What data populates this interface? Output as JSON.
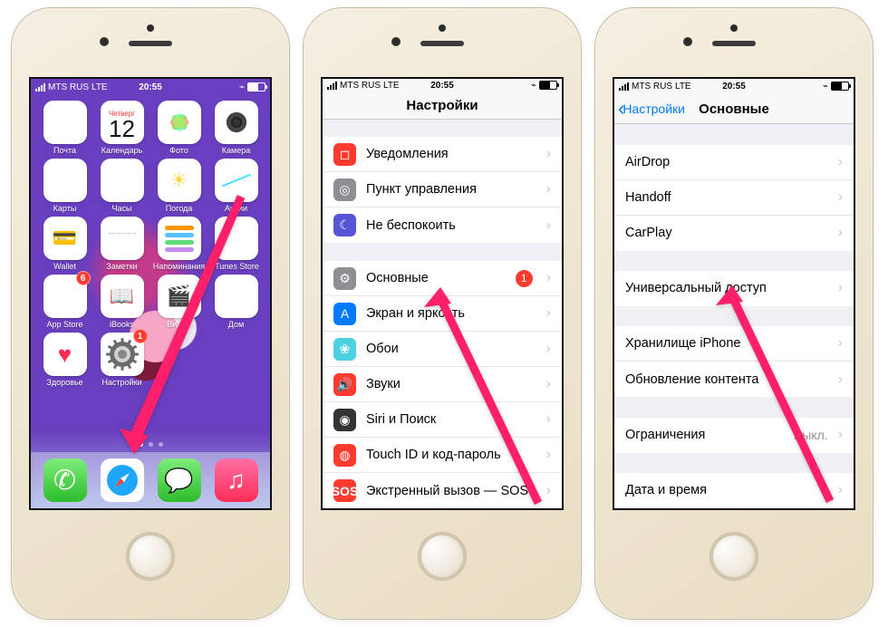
{
  "status": {
    "carrier": "MTS RUS",
    "net": "LTE",
    "time": "20:55"
  },
  "home": {
    "calendar": {
      "dow": "Четверг",
      "day": "12"
    },
    "rows": [
      [
        {
          "name": "mail",
          "label": "Почта",
          "cls": "ic-mail"
        },
        {
          "name": "calendar",
          "label": "Календарь",
          "cls": "ic-cal"
        },
        {
          "name": "photos",
          "label": "Фото",
          "cls": "ic-photos"
        },
        {
          "name": "camera",
          "label": "Камера",
          "cls": "ic-cam"
        }
      ],
      [
        {
          "name": "maps",
          "label": "Карты",
          "cls": "ic-maps"
        },
        {
          "name": "clock",
          "label": "Часы",
          "cls": "ic-clock"
        },
        {
          "name": "weather",
          "label": "Погода",
          "cls": "ic-weather"
        },
        {
          "name": "stocks",
          "label": "Акции",
          "cls": "ic-stocks"
        }
      ],
      [
        {
          "name": "wallet",
          "label": "Wallet",
          "cls": "ic-wallet"
        },
        {
          "name": "notes",
          "label": "Заметки",
          "cls": "ic-notes"
        },
        {
          "name": "reminders",
          "label": "Напоминания",
          "cls": "ic-remind"
        },
        {
          "name": "itunes",
          "label": "iTunes Store",
          "cls": "ic-itunes"
        }
      ],
      [
        {
          "name": "appstore",
          "label": "App Store",
          "cls": "ic-appst",
          "badge": "6"
        },
        {
          "name": "ibooks",
          "label": "iBooks",
          "cls": "ic-ibooks"
        },
        {
          "name": "video",
          "label": "Видео",
          "cls": "ic-video"
        },
        {
          "name": "home",
          "label": "Дом",
          "cls": "ic-home"
        }
      ],
      [
        {
          "name": "health",
          "label": "Здоровье",
          "cls": "ic-health"
        },
        {
          "name": "settings",
          "label": "Настройки",
          "cls": "ic-settings",
          "badge": "1"
        }
      ]
    ],
    "dock": [
      {
        "name": "phone",
        "cls": "ic-phone"
      },
      {
        "name": "safari",
        "cls": "ic-safari"
      },
      {
        "name": "messages",
        "cls": "ic-msg"
      },
      {
        "name": "music",
        "cls": "ic-music"
      }
    ]
  },
  "settings": {
    "title": "Настройки",
    "group1": [
      {
        "name": "notifications",
        "label": "Уведомления",
        "icon": "si-red",
        "glyph": "◻"
      },
      {
        "name": "control-center",
        "label": "Пункт управления",
        "icon": "si-gray",
        "glyph": "◎"
      },
      {
        "name": "dnd",
        "label": "Не беспокоить",
        "icon": "si-purple",
        "glyph": "☾"
      }
    ],
    "group2": [
      {
        "name": "general",
        "label": "Основные",
        "icon": "si-gray",
        "glyph": "⚙",
        "badge": "1"
      },
      {
        "name": "display",
        "label": "Экран и яркость",
        "icon": "si-blue",
        "glyph": "A"
      },
      {
        "name": "wallpaper",
        "label": "Обои",
        "icon": "si-teal",
        "glyph": "❀"
      },
      {
        "name": "sounds",
        "label": "Звуки",
        "icon": "si-red",
        "glyph": "🔊"
      },
      {
        "name": "siri",
        "label": "Siri и Поиск",
        "icon": "si-dark",
        "glyph": "◉"
      },
      {
        "name": "touchid",
        "label": "Touch ID и код-пароль",
        "icon": "si-red",
        "glyph": "◍"
      },
      {
        "name": "sos",
        "label": "Экстренный вызов — SOS",
        "icon": "si-sos",
        "glyph": "SOS"
      }
    ]
  },
  "general": {
    "back": "Настройки",
    "title": "Основные",
    "group1": [
      {
        "name": "airdrop",
        "label": "AirDrop"
      },
      {
        "name": "handoff",
        "label": "Handoff"
      },
      {
        "name": "carplay",
        "label": "CarPlay"
      }
    ],
    "group2": [
      {
        "name": "accessibility",
        "label": "Универсальный доступ"
      }
    ],
    "group3": [
      {
        "name": "storage",
        "label": "Хранилище iPhone"
      },
      {
        "name": "bgrefresh",
        "label": "Обновление контента"
      }
    ],
    "group4": [
      {
        "name": "restrictions",
        "label": "Ограничения",
        "value": "Выкл."
      }
    ],
    "group5": [
      {
        "name": "datetime",
        "label": "Дата и время"
      }
    ]
  },
  "arrow_color": "#ff1f6b"
}
